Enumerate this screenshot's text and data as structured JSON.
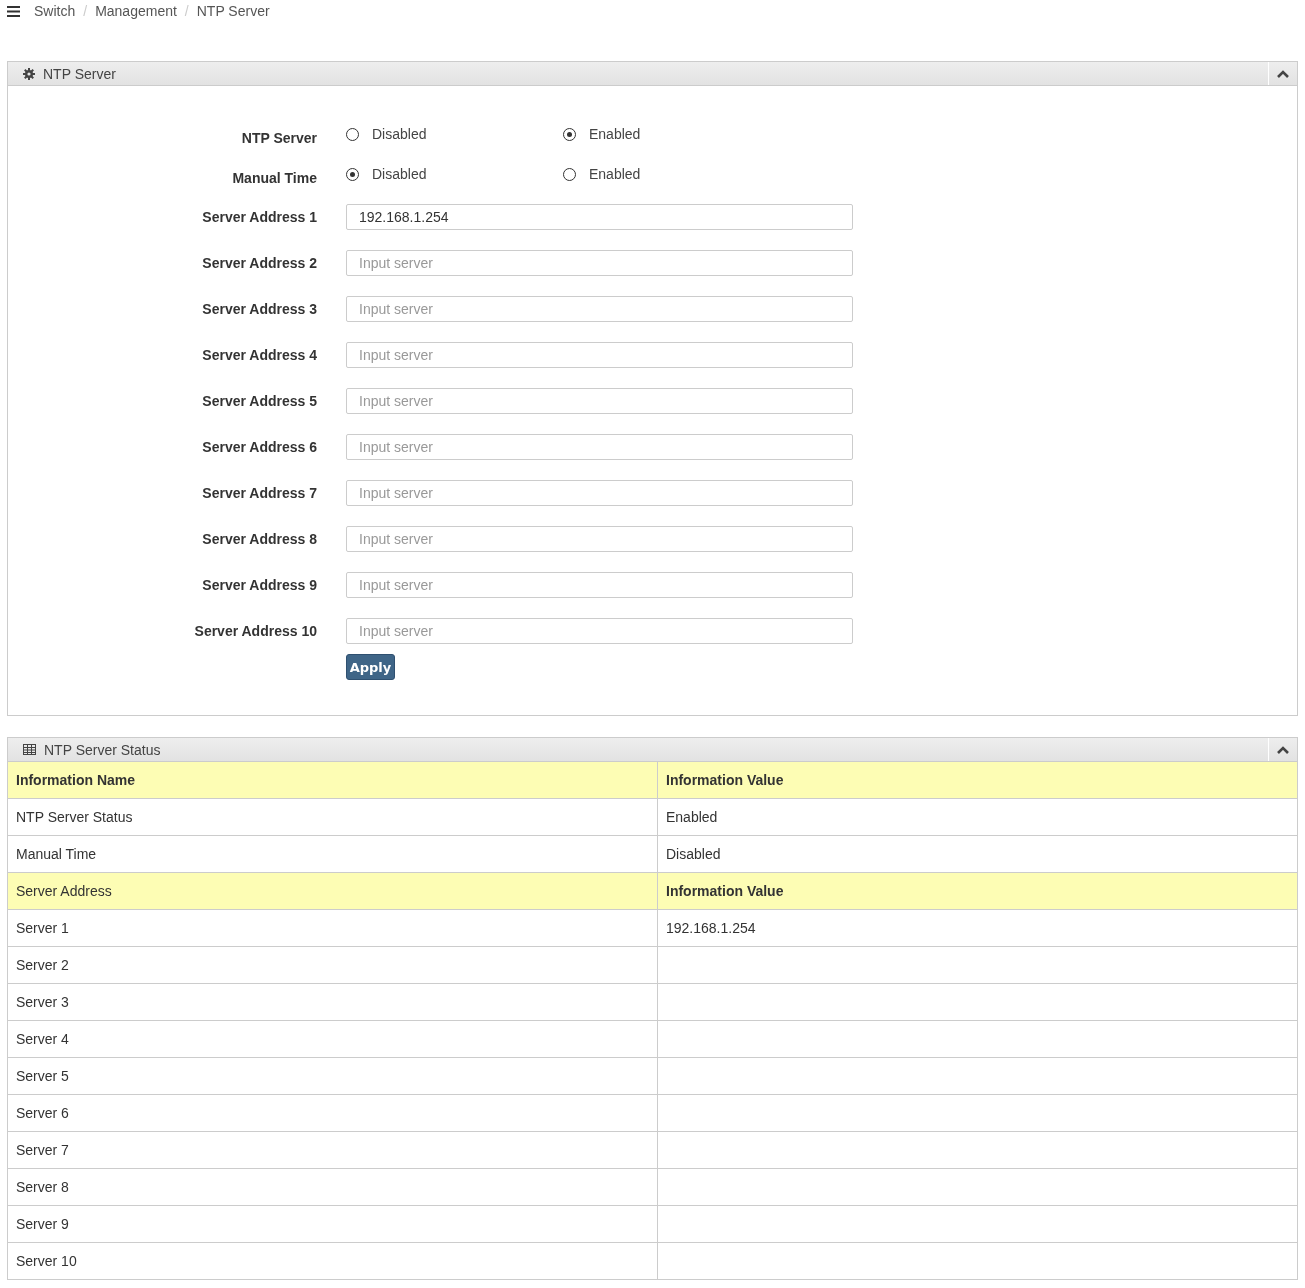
{
  "breadcrumb": {
    "separator": "/",
    "items": [
      "Switch",
      "Management",
      "NTP Server"
    ]
  },
  "settings_panel": {
    "title": "NTP Server",
    "radio_groups": [
      {
        "label": "NTP Server",
        "options": [
          {
            "label": "Disabled",
            "selected": false
          },
          {
            "label": "Enabled",
            "selected": true
          }
        ]
      },
      {
        "label": "Manual Time",
        "options": [
          {
            "label": "Disabled",
            "selected": true
          },
          {
            "label": "Enabled",
            "selected": false
          }
        ]
      }
    ],
    "fields": [
      {
        "label": "Server Address 1",
        "value": "192.168.1.254"
      },
      {
        "label": "Server Address 2",
        "placeholder": "Input server"
      },
      {
        "label": "Server Address 3",
        "placeholder": "Input server"
      },
      {
        "label": "Server Address 4",
        "placeholder": "Input server"
      },
      {
        "label": "Server Address 5",
        "placeholder": "Input server"
      },
      {
        "label": "Server Address 6",
        "placeholder": "Input server"
      },
      {
        "label": "Server Address 7",
        "placeholder": "Input server"
      },
      {
        "label": "Server Address 8",
        "placeholder": "Input server"
      },
      {
        "label": "Server Address 9",
        "placeholder": "Input server"
      },
      {
        "label": "Server Address 10",
        "placeholder": "Input server"
      }
    ],
    "apply_button": "Apply"
  },
  "status_panel": {
    "title": "NTP Server Status",
    "rows": [
      {
        "kind": "header",
        "cells": [
          {
            "text": "Information Name",
            "bold": true
          },
          {
            "text": "Information Value",
            "bold": true
          }
        ]
      },
      {
        "kind": "data",
        "cells": [
          {
            "text": "NTP Server Status",
            "bold": false
          },
          {
            "text": "Enabled",
            "bold": false
          }
        ]
      },
      {
        "kind": "data",
        "cells": [
          {
            "text": "Manual Time",
            "bold": false
          },
          {
            "text": "Disabled",
            "bold": false
          }
        ]
      },
      {
        "kind": "header",
        "cells": [
          {
            "text": "Server Address",
            "bold": false
          },
          {
            "text": "Information Value",
            "bold": true
          }
        ]
      },
      {
        "kind": "data",
        "cells": [
          {
            "text": "Server 1",
            "bold": false
          },
          {
            "text": "192.168.1.254",
            "bold": false
          }
        ]
      },
      {
        "kind": "data",
        "cells": [
          {
            "text": "Server 2",
            "bold": false
          }
        ]
      },
      {
        "kind": "data",
        "cells": [
          {
            "text": "Server 3",
            "bold": false
          }
        ]
      },
      {
        "kind": "data",
        "cells": [
          {
            "text": "Server 4",
            "bold": false
          }
        ]
      },
      {
        "kind": "data",
        "cells": [
          {
            "text": "Server 5",
            "bold": false
          }
        ]
      },
      {
        "kind": "data",
        "cells": [
          {
            "text": "Server 6",
            "bold": false
          }
        ]
      },
      {
        "kind": "data",
        "cells": [
          {
            "text": "Server 7",
            "bold": false
          }
        ]
      },
      {
        "kind": "data",
        "cells": [
          {
            "text": "Server 8",
            "bold": false
          }
        ]
      },
      {
        "kind": "data",
        "cells": [
          {
            "text": "Server 9",
            "bold": false
          }
        ]
      },
      {
        "kind": "data",
        "cells": [
          {
            "text": "Server 10",
            "bold": false
          }
        ]
      }
    ]
  }
}
